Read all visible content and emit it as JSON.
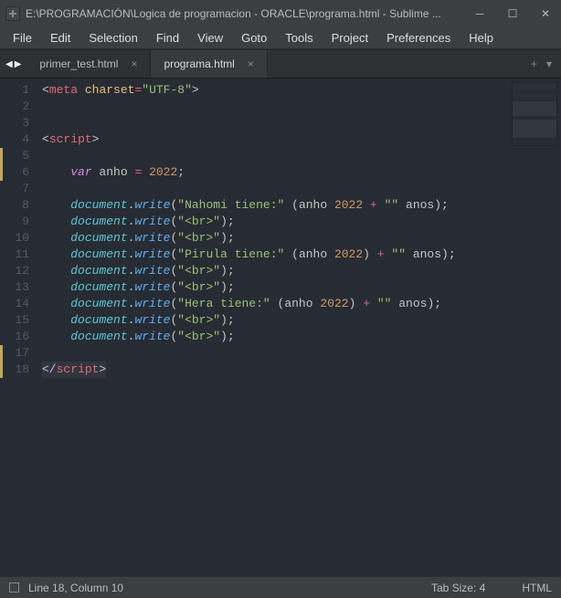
{
  "titlebar": {
    "title": "E:\\PROGRAMACIÓN\\Logica de programacion - ORACLE\\programa.html - Sublime ..."
  },
  "menubar": [
    "File",
    "Edit",
    "Selection",
    "Find",
    "View",
    "Goto",
    "Tools",
    "Project",
    "Preferences",
    "Help"
  ],
  "tabs": [
    {
      "label": "primer_test.html",
      "active": false
    },
    {
      "label": "programa.html",
      "active": true
    }
  ],
  "code": {
    "lines": [
      {
        "n": 1,
        "mod": false,
        "tokens": [
          [
            "punc",
            "<"
          ],
          [
            "tag",
            "meta"
          ],
          [
            "id",
            " "
          ],
          [
            "attr",
            "charset"
          ],
          [
            "op",
            "="
          ],
          [
            "str",
            "\"UTF-8\""
          ],
          [
            "punc",
            ">"
          ]
        ]
      },
      {
        "n": 2,
        "mod": false,
        "tokens": []
      },
      {
        "n": 3,
        "mod": false,
        "tokens": []
      },
      {
        "n": 4,
        "mod": false,
        "tokens": [
          [
            "punc",
            "<"
          ],
          [
            "tag",
            "script"
          ],
          [
            "punc",
            ">"
          ]
        ]
      },
      {
        "n": 5,
        "mod": true,
        "tokens": []
      },
      {
        "n": 6,
        "mod": true,
        "tokens": [
          [
            "id",
            "    "
          ],
          [
            "key",
            "var"
          ],
          [
            "id",
            " anho "
          ],
          [
            "op",
            "="
          ],
          [
            "id",
            " "
          ],
          [
            "num",
            "2022"
          ],
          [
            "punc",
            ";"
          ]
        ]
      },
      {
        "n": 7,
        "mod": false,
        "tokens": []
      },
      {
        "n": 8,
        "mod": false,
        "tokens": [
          [
            "id",
            "    "
          ],
          [
            "obj",
            "document"
          ],
          [
            "punc",
            "."
          ],
          [
            "fn",
            "write"
          ],
          [
            "punc",
            "("
          ],
          [
            "str",
            "\"Nahomi tiene:\""
          ],
          [
            "id",
            " "
          ],
          [
            "punc",
            "("
          ],
          [
            "id",
            "anho "
          ],
          [
            "num",
            "2022"
          ],
          [
            "id",
            " "
          ],
          [
            "op",
            "+"
          ],
          [
            "id",
            " "
          ],
          [
            "str",
            "\"\""
          ],
          [
            "id",
            " anos"
          ],
          [
            "punc",
            ")"
          ],
          [
            "punc",
            ";"
          ]
        ]
      },
      {
        "n": 9,
        "mod": false,
        "tokens": [
          [
            "id",
            "    "
          ],
          [
            "obj",
            "document"
          ],
          [
            "punc",
            "."
          ],
          [
            "fn",
            "write"
          ],
          [
            "punc",
            "("
          ],
          [
            "str",
            "\"<br>\""
          ],
          [
            "punc",
            ")"
          ],
          [
            "punc",
            ";"
          ]
        ]
      },
      {
        "n": 10,
        "mod": false,
        "tokens": [
          [
            "id",
            "    "
          ],
          [
            "obj",
            "document"
          ],
          [
            "punc",
            "."
          ],
          [
            "fn",
            "write"
          ],
          [
            "punc",
            "("
          ],
          [
            "str",
            "\"<br>\""
          ],
          [
            "punc",
            ")"
          ],
          [
            "punc",
            ";"
          ]
        ]
      },
      {
        "n": 11,
        "mod": false,
        "tokens": [
          [
            "id",
            "    "
          ],
          [
            "obj",
            "document"
          ],
          [
            "punc",
            "."
          ],
          [
            "fn",
            "write"
          ],
          [
            "punc",
            "("
          ],
          [
            "str",
            "\"Pirula tiene:\""
          ],
          [
            "id",
            " "
          ],
          [
            "punc",
            "("
          ],
          [
            "id",
            "anho "
          ],
          [
            "num",
            "2022"
          ],
          [
            "punc",
            ")"
          ],
          [
            "id",
            " "
          ],
          [
            "op",
            "+"
          ],
          [
            "id",
            " "
          ],
          [
            "str",
            "\"\""
          ],
          [
            "id",
            " anos"
          ],
          [
            "punc",
            ")"
          ],
          [
            "punc",
            ";"
          ]
        ]
      },
      {
        "n": 12,
        "mod": false,
        "tokens": [
          [
            "id",
            "    "
          ],
          [
            "obj",
            "document"
          ],
          [
            "punc",
            "."
          ],
          [
            "fn",
            "write"
          ],
          [
            "punc",
            "("
          ],
          [
            "str",
            "\"<br>\""
          ],
          [
            "punc",
            ")"
          ],
          [
            "punc",
            ";"
          ]
        ]
      },
      {
        "n": 13,
        "mod": false,
        "tokens": [
          [
            "id",
            "    "
          ],
          [
            "obj",
            "document"
          ],
          [
            "punc",
            "."
          ],
          [
            "fn",
            "write"
          ],
          [
            "punc",
            "("
          ],
          [
            "str",
            "\"<br>\""
          ],
          [
            "punc",
            ")"
          ],
          [
            "punc",
            ";"
          ]
        ]
      },
      {
        "n": 14,
        "mod": false,
        "tokens": [
          [
            "id",
            "    "
          ],
          [
            "obj",
            "document"
          ],
          [
            "punc",
            "."
          ],
          [
            "fn",
            "write"
          ],
          [
            "punc",
            "("
          ],
          [
            "str",
            "\"Hera tiene:\""
          ],
          [
            "id",
            " "
          ],
          [
            "punc",
            "("
          ],
          [
            "id",
            "anho "
          ],
          [
            "num",
            "2022"
          ],
          [
            "punc",
            ")"
          ],
          [
            "id",
            " "
          ],
          [
            "op",
            "+"
          ],
          [
            "id",
            " "
          ],
          [
            "str",
            "\"\""
          ],
          [
            "id",
            " anos"
          ],
          [
            "punc",
            ")"
          ],
          [
            "punc",
            ";"
          ]
        ]
      },
      {
        "n": 15,
        "mod": false,
        "tokens": [
          [
            "id",
            "    "
          ],
          [
            "obj",
            "document"
          ],
          [
            "punc",
            "."
          ],
          [
            "fn",
            "write"
          ],
          [
            "punc",
            "("
          ],
          [
            "str",
            "\"<br>\""
          ],
          [
            "punc",
            ")"
          ],
          [
            "punc",
            ";"
          ]
        ]
      },
      {
        "n": 16,
        "mod": false,
        "tokens": [
          [
            "id",
            "    "
          ],
          [
            "obj",
            "document"
          ],
          [
            "punc",
            "."
          ],
          [
            "fn",
            "write"
          ],
          [
            "punc",
            "("
          ],
          [
            "str",
            "\"<br>\""
          ],
          [
            "punc",
            ")"
          ],
          [
            "punc",
            ";"
          ]
        ]
      },
      {
        "n": 17,
        "mod": true,
        "tokens": []
      },
      {
        "n": 18,
        "mod": true,
        "tokens": [
          [
            "punc",
            "</"
          ],
          [
            "tag",
            "script"
          ],
          [
            "punc",
            ">"
          ]
        ],
        "current": true
      }
    ]
  },
  "statusbar": {
    "position": "Line 18, Column 10",
    "tab_size": "Tab Size: 4",
    "syntax": "HTML"
  }
}
